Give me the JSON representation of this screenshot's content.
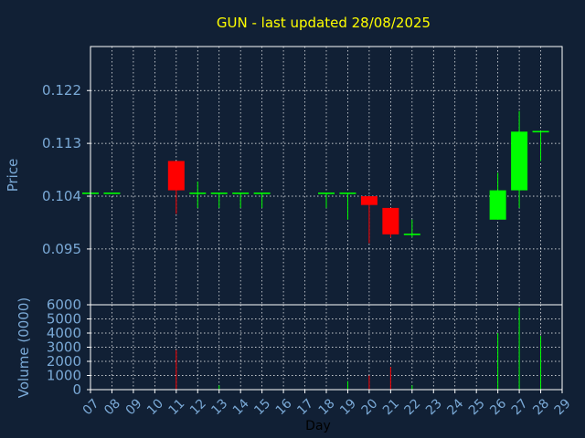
{
  "chart_data": {
    "type": "candlestick",
    "title": "GUN - last updated 28/08/2025",
    "xlabel": "Day",
    "price_panel": {
      "ylabel": "Price",
      "ylim": [
        0.0855,
        0.1295
      ],
      "yticks": [
        "0.095",
        "0.104",
        "0.113",
        "0.122"
      ],
      "ytick_values": [
        0.095,
        0.104,
        0.113,
        0.122
      ],
      "grid": true
    },
    "volume_panel": {
      "ylabel": "Volume (0000)",
      "ylim": [
        0,
        6000
      ],
      "yticks": [
        "0",
        "1000",
        "2000",
        "3000",
        "4000",
        "5000",
        "6000"
      ],
      "ytick_values": [
        0,
        1000,
        2000,
        3000,
        4000,
        5000,
        6000
      ],
      "grid": true
    },
    "x_ticks": [
      "07",
      "08",
      "09",
      "10",
      "11",
      "12",
      "13",
      "14",
      "15",
      "16",
      "17",
      "18",
      "19",
      "20",
      "21",
      "22",
      "23",
      "24",
      "25",
      "26",
      "27",
      "28",
      "29"
    ],
    "candles": [
      {
        "day": "07",
        "open": 0.1045,
        "high": 0.1045,
        "low": 0.1045,
        "close": 0.1045,
        "volume": 0
      },
      {
        "day": "08",
        "open": 0.1045,
        "high": 0.1045,
        "low": 0.1045,
        "close": 0.1045,
        "volume": 0
      },
      {
        "day": "11",
        "open": 0.11,
        "high": 0.11,
        "low": 0.101,
        "close": 0.105,
        "volume": 2800
      },
      {
        "day": "12",
        "open": 0.1045,
        "high": 0.1065,
        "low": 0.102,
        "close": 0.1045,
        "volume": 0
      },
      {
        "day": "13",
        "open": 0.1045,
        "high": 0.1045,
        "low": 0.102,
        "close": 0.1045,
        "volume": 300
      },
      {
        "day": "14",
        "open": 0.1045,
        "high": 0.1045,
        "low": 0.102,
        "close": 0.1045,
        "volume": 0
      },
      {
        "day": "15",
        "open": 0.1045,
        "high": 0.1045,
        "low": 0.102,
        "close": 0.1045,
        "volume": 0
      },
      {
        "day": "18",
        "open": 0.1045,
        "high": 0.1045,
        "low": 0.102,
        "close": 0.1045,
        "volume": 0
      },
      {
        "day": "19",
        "open": 0.1045,
        "high": 0.1045,
        "low": 0.1,
        "close": 0.1045,
        "volume": 600
      },
      {
        "day": "20",
        "open": 0.104,
        "high": 0.104,
        "low": 0.096,
        "close": 0.1025,
        "volume": 1000
      },
      {
        "day": "21",
        "open": 0.102,
        "high": 0.102,
        "low": 0.097,
        "close": 0.0975,
        "volume": 1600
      },
      {
        "day": "22",
        "open": 0.0975,
        "high": 0.1,
        "low": 0.097,
        "close": 0.0975,
        "volume": 300
      },
      {
        "day": "26",
        "open": 0.1,
        "high": 0.108,
        "low": 0.1,
        "close": 0.105,
        "volume": 4000
      },
      {
        "day": "27",
        "open": 0.105,
        "high": 0.1185,
        "low": 0.102,
        "close": 0.115,
        "volume": 5800
      },
      {
        "day": "28",
        "open": 0.115,
        "high": 0.115,
        "low": 0.11,
        "close": 0.115,
        "volume": 3800
      }
    ],
    "colors": {
      "background": "#112035",
      "plot_edge": "#ffffff",
      "grid": "#ffffff",
      "up": "#00ff00",
      "down": "#ff0000",
      "title": "#ffff00",
      "tick_text": "#7aa9d6",
      "xlabel_text": "#000000"
    }
  }
}
